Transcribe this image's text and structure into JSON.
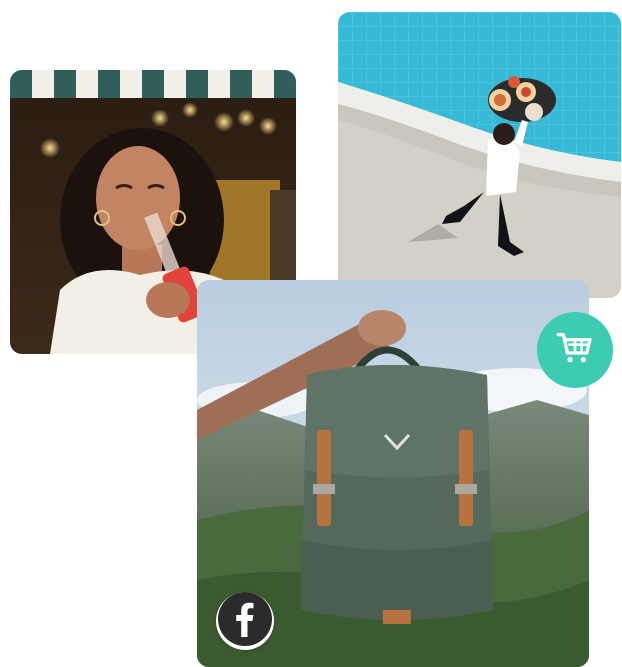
{
  "photos": [
    {
      "name": "woman-drinking-soda-photo"
    },
    {
      "name": "waiter-serving-food-pool-photo"
    },
    {
      "name": "hand-holding-backpack-photo"
    }
  ],
  "badges": {
    "cart": {
      "icon": "shopping-cart-icon",
      "color": "#3ecbb3"
    },
    "facebook": {
      "icon": "facebook-icon",
      "color": "#2b2b2b"
    }
  }
}
